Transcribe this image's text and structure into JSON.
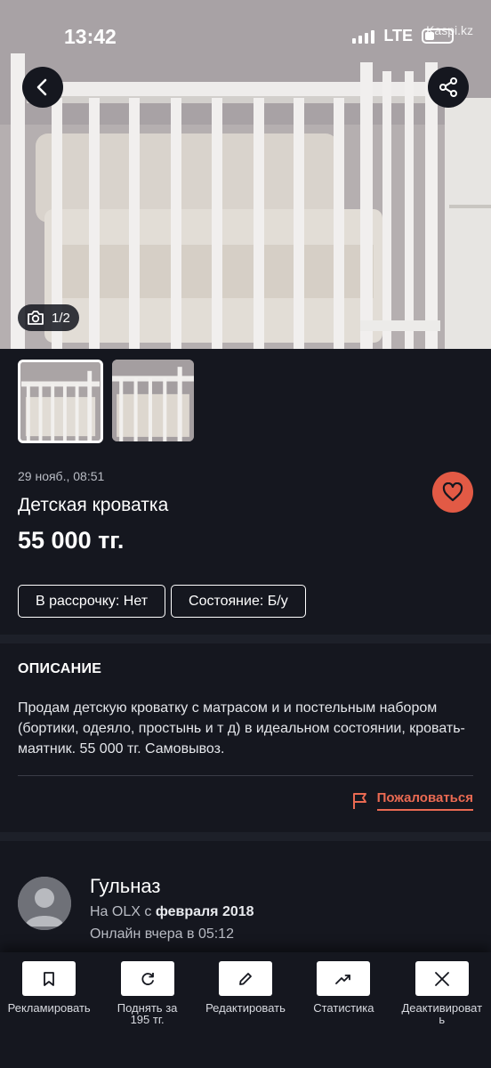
{
  "status_bar": {
    "time": "13:42",
    "network": "LTE",
    "watermark": "Kaspi.kz"
  },
  "gallery": {
    "counter": "1/2",
    "thumbnail_count": 2
  },
  "listing": {
    "date": "29 нояб., 08:51",
    "title": "Детская кроватка",
    "price": "55 000 тг.",
    "tags": [
      "В рассрочку: Нет",
      "Состояние: Б/у"
    ]
  },
  "description": {
    "heading": "ОПИСАНИЕ",
    "text": "Продам детскую кроватку с матрасом и и постельным набором (бортики, одеяло, простынь и т д) в идеальном состоянии, кровать-маятник. 55 000 тг. Самовывоз.",
    "report_label": "Пожаловаться"
  },
  "seller": {
    "name": "Гульназ",
    "since_prefix": "На OLX с ",
    "since_date": "февраля 2018",
    "online": "Онлайн вчера в 05:12"
  },
  "actions": [
    {
      "label": "Рекламировать",
      "icon": "bookmark-icon"
    },
    {
      "label": "Поднять за 195 тг.",
      "icon": "refresh-icon"
    },
    {
      "label": "Редактировать",
      "icon": "pencil-icon"
    },
    {
      "label": "Статистика",
      "icon": "trend-icon"
    },
    {
      "label": "Деактивировать",
      "icon": "close-icon"
    }
  ],
  "colors": {
    "background": "#15171f",
    "accent": "#e25a45",
    "report": "#ea6a52"
  }
}
